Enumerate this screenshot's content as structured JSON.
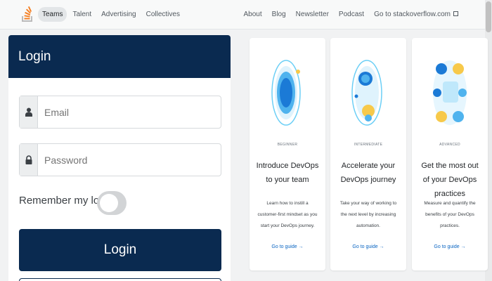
{
  "nav": {
    "left": [
      "Teams",
      "Talent",
      "Advertising",
      "Collectives"
    ],
    "right": [
      "About",
      "Blog",
      "Newsletter",
      "Podcast",
      "Go to stackoverflow.com"
    ]
  },
  "login": {
    "title": "Login",
    "email_placeholder": "Email",
    "password_placeholder": "Password",
    "remember_label": "Remember my login",
    "remember_on": false,
    "button_label": "Login"
  },
  "guides": [
    {
      "level": "BEGINNER",
      "title": "Introduce DevOps to your team",
      "description": "Learn how to instill a customer-first mindset as you start your DevOps journey.",
      "cta": "Go to guide →"
    },
    {
      "level": "INTERMEDIATE",
      "title": "Accelerate your DevOps journey",
      "description": "Take your way of working to the next level by increasing automation.",
      "cta": "Go to guide →"
    },
    {
      "level": "ADVANCED",
      "title": "Get the most out of your DevOps practices",
      "description": "Measure and quantify the benefits of your DevOps practices.",
      "cta": "Go to guide →"
    }
  ],
  "colors": {
    "accent": "#0a2a50",
    "link": "#0a65c2",
    "logo": "#f48024"
  },
  "icons": {
    "user": "user-icon",
    "lock": "lock-icon",
    "external": "external-link-icon"
  }
}
